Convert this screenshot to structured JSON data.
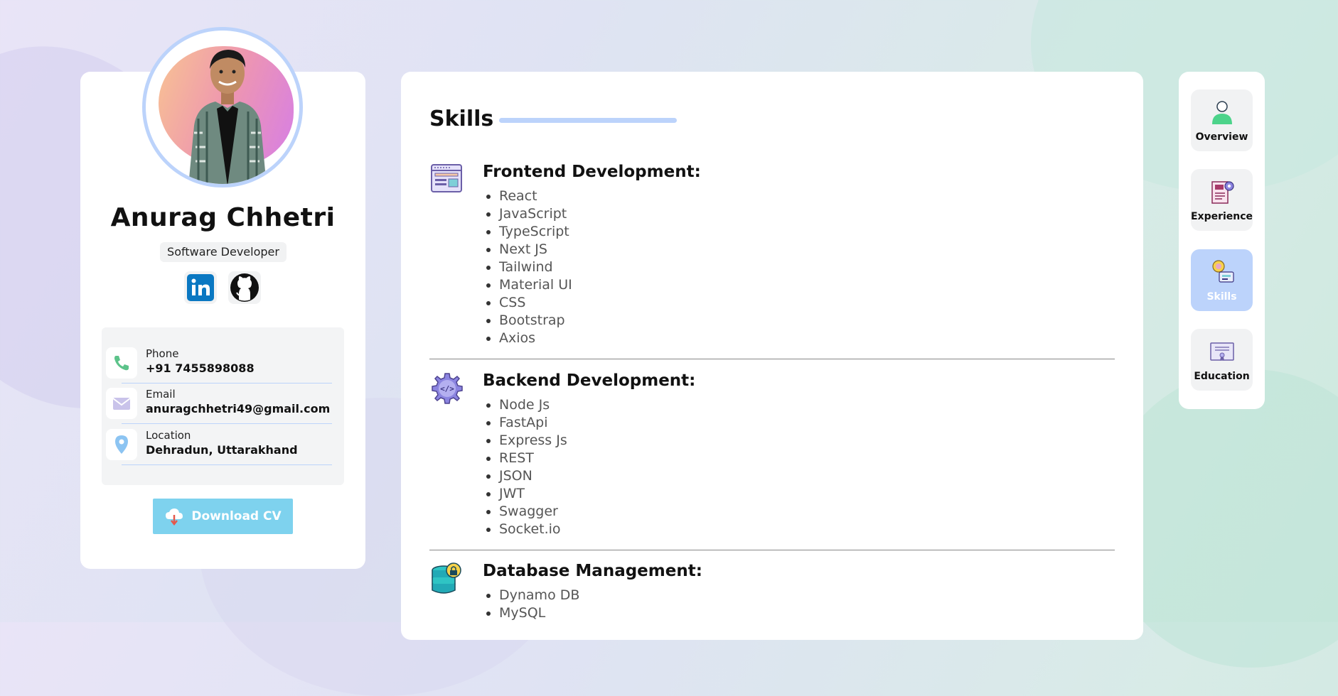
{
  "profile": {
    "name": "Anurag Chhetri",
    "role": "Software Developer",
    "social": [
      "linkedin-icon",
      "github-icon"
    ],
    "contacts": [
      {
        "label": "Phone",
        "value": "+91 7455898088",
        "icon": "phone-icon"
      },
      {
        "label": "Email",
        "value": "anuragchhetri49@gmail.com",
        "icon": "mail-icon"
      },
      {
        "label": "Location",
        "value": "Dehradun, Uttarakhand",
        "icon": "location-pin-icon"
      }
    ],
    "download_label": "Download CV"
  },
  "skills": {
    "title": "Skills",
    "groups": [
      {
        "heading": "Frontend Development:",
        "icon": "browser-window-icon",
        "items": [
          "React",
          "JavaScript",
          "TypeScript",
          "Next JS",
          "Tailwind",
          "Material UI",
          "CSS",
          "Bootstrap",
          "Axios"
        ]
      },
      {
        "heading": "Backend Development:",
        "icon": "code-gear-icon",
        "items": [
          "Node Js",
          "FastApi",
          "Express Js",
          "REST",
          "JSON",
          "JWT",
          "Swagger",
          "Socket.io"
        ]
      },
      {
        "heading": "Database Management:",
        "icon": "database-lock-icon",
        "items": [
          "Dynamo DB",
          "MySQL"
        ]
      }
    ]
  },
  "nav": [
    {
      "label": "Overview",
      "icon": "user-icon",
      "active": false
    },
    {
      "label": "Experience",
      "icon": "resume-document-icon",
      "active": false
    },
    {
      "label": "Skills",
      "icon": "skills-award-icon",
      "active": true
    },
    {
      "label": "Education",
      "icon": "certificate-icon",
      "active": false
    }
  ],
  "colors": {
    "accent": "#bcd3fb",
    "download_button": "#7ed2ee",
    "card": "#ffffff"
  }
}
